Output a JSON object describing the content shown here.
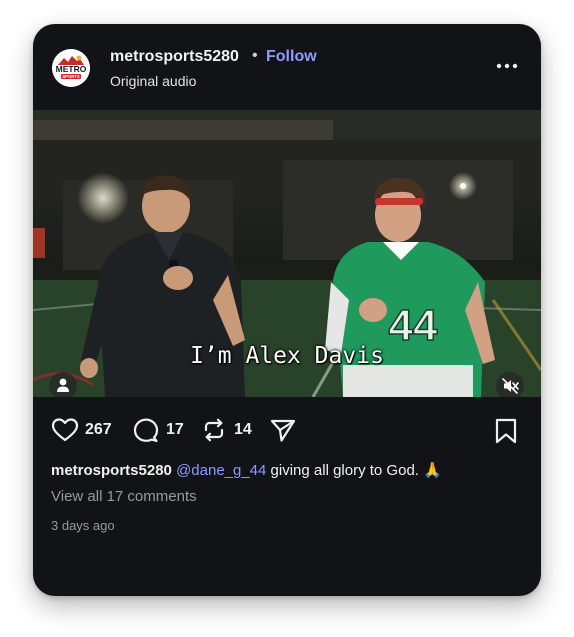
{
  "post": {
    "username": "metrosports5280",
    "separator": "•",
    "follow_label": "Follow",
    "audio_label": "Original audio",
    "avatar_text": "METRO",
    "avatar_subtext": "SPORTS",
    "video_caption": "I’m Alex Davis",
    "jersey_number": "44",
    "likes": "267",
    "comments_count": "17",
    "reposts": "14",
    "caption_user": "metrosports5280",
    "caption_mention": "@dane_g_44",
    "caption_text": " giving all glory to God. 🙏",
    "view_comments": "View all 17 comments",
    "timestamp": "3 days ago"
  },
  "colors": {
    "card_bg": "#121316",
    "link_accent": "#8e9bff",
    "jersey_green": "#1f9a5c"
  },
  "icons": [
    "metro-sports-logo",
    "more-options-icon",
    "tag-people-icon",
    "muted-icon",
    "heart-icon",
    "comment-icon",
    "repost-icon",
    "share-icon",
    "bookmark-icon"
  ]
}
